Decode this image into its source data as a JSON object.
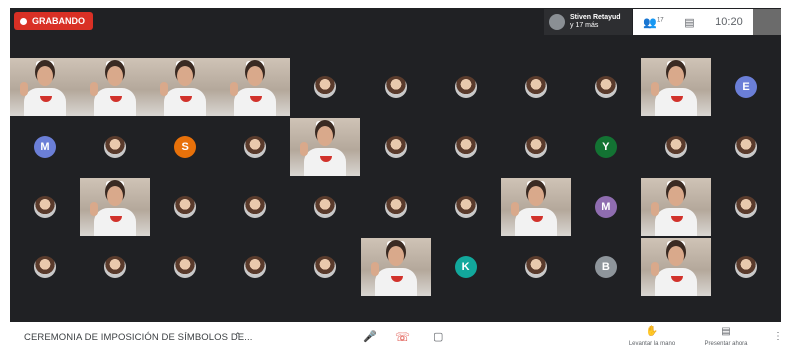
{
  "recording": {
    "label": "GRABANDO"
  },
  "presenter": {
    "name": "Stiven Retayud",
    "more": "y 17 más"
  },
  "toolbar": {
    "people_icon": "people-icon",
    "people_count": "17",
    "chat_icon": "chat-icon",
    "time": "10:20"
  },
  "meeting": {
    "title": "CEREMONIA DE IMPOSICIÓN DE SÍMBOLOS DE..."
  },
  "controls": {
    "mic_icon": "mic-icon",
    "hangup_icon": "hangup-icon",
    "camera_icon": "camera-icon",
    "raise_hand_label": "Levantar la mano",
    "present_label": "Presentar ahora"
  },
  "colors": {
    "recording": "#d93025",
    "stage": "#202124",
    "tile": "#3c4043",
    "avatar_blue": "#6b7fd7",
    "avatar_orange": "#e8710a",
    "avatar_green": "#137333",
    "avatar_purple": "#8f6db0",
    "avatar_teal": "#12a89c",
    "avatar_grey": "#8e959b"
  },
  "tiles": [
    {
      "kind": "video"
    },
    {
      "kind": "video"
    },
    {
      "kind": "video"
    },
    {
      "kind": "video"
    },
    {
      "kind": "photo"
    },
    {
      "kind": "photo"
    },
    {
      "kind": "photo"
    },
    {
      "kind": "photo"
    },
    {
      "kind": "photo"
    },
    {
      "kind": "video"
    },
    {
      "kind": "letter",
      "letter": "E",
      "color": "#6b7fd7"
    },
    {
      "kind": "letter",
      "letter": "M",
      "color": "#6b7fd7"
    },
    {
      "kind": "photo"
    },
    {
      "kind": "letter",
      "letter": "S",
      "color": "#e8710a"
    },
    {
      "kind": "photo"
    },
    {
      "kind": "video"
    },
    {
      "kind": "photo"
    },
    {
      "kind": "photo"
    },
    {
      "kind": "photo"
    },
    {
      "kind": "letter",
      "letter": "Y",
      "color": "#137333"
    },
    {
      "kind": "photo"
    },
    {
      "kind": "photo"
    },
    {
      "kind": "photo"
    },
    {
      "kind": "video"
    },
    {
      "kind": "photo"
    },
    {
      "kind": "photo"
    },
    {
      "kind": "photo"
    },
    {
      "kind": "photo"
    },
    {
      "kind": "photo"
    },
    {
      "kind": "video"
    },
    {
      "kind": "letter",
      "letter": "M",
      "color": "#8f6db0"
    },
    {
      "kind": "video"
    },
    {
      "kind": "photo"
    },
    {
      "kind": "photo"
    },
    {
      "kind": "photo"
    },
    {
      "kind": "photo"
    },
    {
      "kind": "photo"
    },
    {
      "kind": "photo"
    },
    {
      "kind": "video"
    },
    {
      "kind": "letter",
      "letter": "K",
      "color": "#12a89c"
    },
    {
      "kind": "photo"
    },
    {
      "kind": "letter",
      "letter": "B",
      "color": "#8e959b"
    },
    {
      "kind": "video"
    },
    {
      "kind": "photo"
    }
  ]
}
